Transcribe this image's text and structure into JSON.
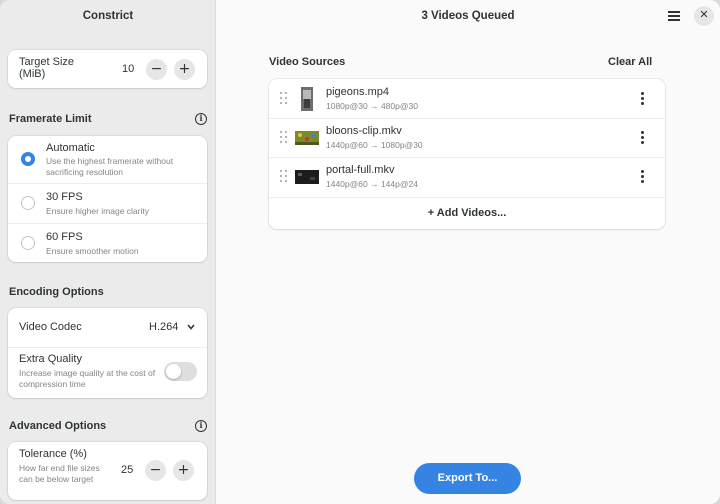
{
  "sidebar": {
    "title": "Constrict",
    "target_size": {
      "label": "Target Size\n(MiB)",
      "value": "10",
      "minus": "−",
      "plus": "+"
    },
    "framerate": {
      "heading": "Framerate Limit",
      "options": [
        {
          "label": "Automatic",
          "desc": "Use the highest framerate without sacrificing resolution",
          "selected": true
        },
        {
          "label": "30 FPS",
          "desc": "Ensure higher image clarity",
          "selected": false
        },
        {
          "label": "60 FPS",
          "desc": "Ensure smoother motion",
          "selected": false
        }
      ]
    },
    "encoding": {
      "heading": "Encoding Options",
      "codec_label": "Video Codec",
      "codec_value": "H.264",
      "extra_label": "Extra Quality",
      "extra_desc": "Increase image quality at the cost of compression time",
      "extra_on": false
    },
    "advanced": {
      "heading": "Advanced Options",
      "tolerance_label": "Tolerance (%)",
      "tolerance_desc": "How far end file sizes can be below target",
      "tolerance_value": "25",
      "minus": "−",
      "plus": "+"
    }
  },
  "main": {
    "title": "3 Videos Queued",
    "close": "✕",
    "sources_heading": "Video Sources",
    "clear_all": "Clear All",
    "videos": [
      {
        "name": "pigeons.mp4",
        "meta": "1080p@30 → 480p@30"
      },
      {
        "name": "bloons-clip.mkv",
        "meta": "1440p@60 → 1080p@30"
      },
      {
        "name": "portal-full.mkv",
        "meta": "1440p@60 → 144p@24"
      }
    ],
    "add_videos": "+ Add Videos...",
    "export": "Export To..."
  },
  "colors": {
    "accent": "#3584e4",
    "sidebar_bg": "#ebebeb",
    "main_bg": "#fafafa"
  }
}
